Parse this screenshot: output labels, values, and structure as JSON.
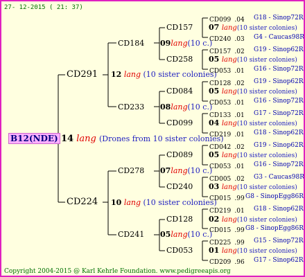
{
  "date": "27- 12-2015 ( 21: 37)",
  "root": {
    "label": "B12(NDE)",
    "num": "14",
    "lang": "lang",
    "desc": "(Drones from 10 sister colonies)"
  },
  "gen1": [
    {
      "label": "CD291",
      "num": "12",
      "lang": "lang",
      "desc": "(10 sister colonies)"
    },
    {
      "label": "CD224",
      "num": "10",
      "lang": "lang",
      "desc": "(10 sister colonies)"
    }
  ],
  "gen2": [
    {
      "label": "CD184",
      "num": "09",
      "lang": "lang",
      "desc": "(10 c.)"
    },
    {
      "label": "CD233",
      "num": "08",
      "lang": "lang",
      "desc": "(10 c.)"
    },
    {
      "label": "CD278",
      "num": "07",
      "lang": "lang",
      "desc": "(10 c.)"
    },
    {
      "label": "CD241",
      "num": "05",
      "lang": "lang",
      "desc": "(10 c.)"
    }
  ],
  "gen3": [
    {
      "label": "CD157",
      "num": "07",
      "lang": "lang",
      "desc": "(10 sister colonies)"
    },
    {
      "label": "CD258",
      "num": "05",
      "lang": "lang",
      "desc": "(10 sister colonies)"
    },
    {
      "label": "CD084",
      "num": "05",
      "lang": "lang",
      "desc": "(10 sister colonies)"
    },
    {
      "label": "CD099",
      "num": "04",
      "lang": "lang",
      "desc": "(10 sister colonies)"
    },
    {
      "label": "CD089",
      "num": "05",
      "lang": "lang",
      "desc": "(10 sister colonies)"
    },
    {
      "label": "CD240",
      "num": "03",
      "lang": "lang",
      "desc": "(10 sister colonies)"
    },
    {
      "label": "CD128",
      "num": "02",
      "lang": "lang",
      "desc": "(10 sister colonies)"
    },
    {
      "label": "CD053",
      "num": "01",
      "lang": "lang",
      "desc": "(10 sister colonies)"
    }
  ],
  "gen4": [
    {
      "id": "CD099",
      "seq": ".04",
      "loc": "G18 - Sinop72R"
    },
    {
      "id": "CD240",
      "seq": ".03",
      "loc": "G4 - Caucas98R"
    },
    {
      "id": "CD157",
      "seq": ".02",
      "loc": "G19 - Sinop62R"
    },
    {
      "id": "CD053",
      "seq": ".01",
      "loc": "G16 - Sinop72R"
    },
    {
      "id": "CD128",
      "seq": ".02",
      "loc": "G19 - Sinop62R"
    },
    {
      "id": "CD053",
      "seq": ".01",
      "loc": "G16 - Sinop72R"
    },
    {
      "id": "CD133",
      "seq": ".01",
      "loc": "G17 - Sinop72R"
    },
    {
      "id": "CD219",
      "seq": ".01",
      "loc": "G18 - Sinop62R"
    },
    {
      "id": "CD042",
      "seq": ".02",
      "loc": "G19 - Sinop62R"
    },
    {
      "id": "CD053",
      "seq": ".01",
      "loc": "G16 - Sinop72R"
    },
    {
      "id": "CD005",
      "seq": ".02",
      "loc": "G3 - Caucas98R"
    },
    {
      "id": "CD015",
      "seq": ".99",
      "loc": "G8 - SinopEgg86R"
    },
    {
      "id": "CD219",
      "seq": ".01",
      "loc": "G18 - Sinop62R"
    },
    {
      "id": "CD015",
      "seq": ".99",
      "loc": "G8 - SinopEgg86R"
    },
    {
      "id": "CD225",
      "seq": ".99",
      "loc": "G15 - Sinop72R"
    },
    {
      "id": "CD209",
      "seq": ".96",
      "loc": "G17 - Sinop62R"
    }
  ],
  "footer": "Copyright 2004-2015 @ Karl Kehrle Foundation.   www.pedigreeapis.org"
}
